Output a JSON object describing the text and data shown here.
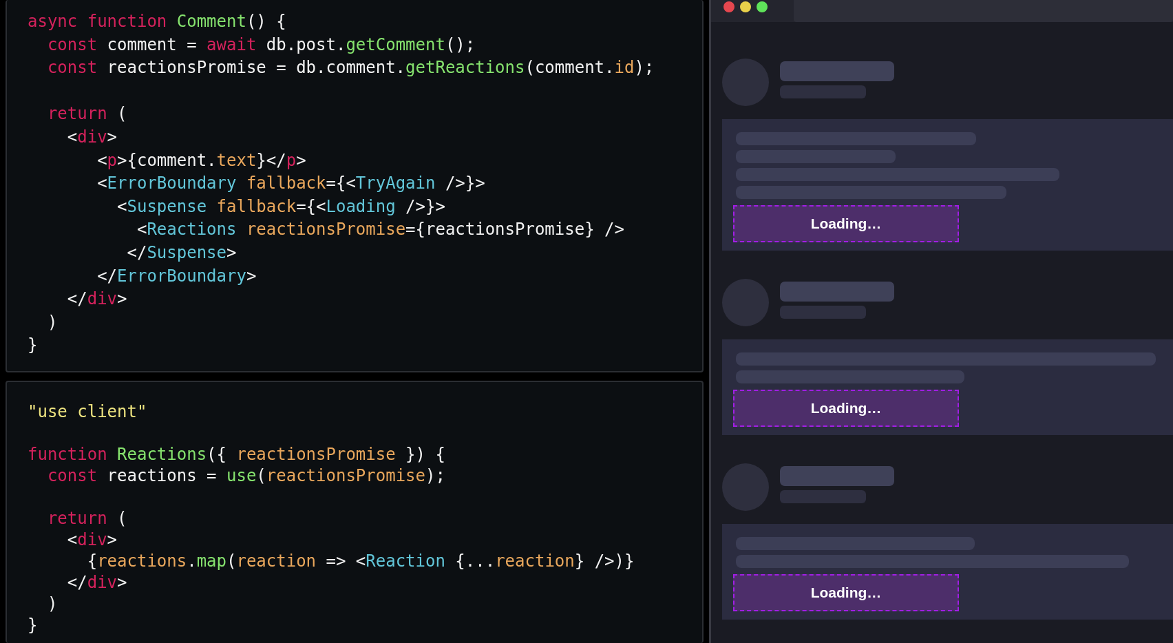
{
  "code_panels": [
    {
      "lines": [
        [
          {
            "kind": "keyword",
            "text": "async function "
          },
          {
            "kind": "fn",
            "text": "Comment"
          },
          {
            "kind": "plain",
            "text": "() {"
          }
        ],
        [
          {
            "kind": "keyword",
            "text": "  const "
          },
          {
            "kind": "plain",
            "text": "comment = "
          },
          {
            "kind": "keyword",
            "text": "await "
          },
          {
            "kind": "plain",
            "text": "db.post."
          },
          {
            "kind": "fn",
            "text": "getComment"
          },
          {
            "kind": "plain",
            "text": "();"
          }
        ],
        [
          {
            "kind": "keyword",
            "text": "  const "
          },
          {
            "kind": "plain",
            "text": "reactionsPromise = db.comment."
          },
          {
            "kind": "fn",
            "text": "getReactions"
          },
          {
            "kind": "plain",
            "text": "(comment."
          },
          {
            "kind": "attr",
            "text": "id"
          },
          {
            "kind": "plain",
            "text": ");"
          }
        ],
        [
          {
            "kind": "blank"
          }
        ],
        [
          {
            "kind": "keyword",
            "text": "  return "
          },
          {
            "kind": "plain",
            "text": "("
          }
        ],
        [
          {
            "kind": "plain",
            "text": "    <"
          },
          {
            "kind": "keyword",
            "text": "div"
          },
          {
            "kind": "plain",
            "text": ">"
          }
        ],
        [
          {
            "kind": "plain",
            "text": "       <"
          },
          {
            "kind": "keyword",
            "text": "p"
          },
          {
            "kind": "plain",
            "text": ">{comment."
          },
          {
            "kind": "attr",
            "text": "text"
          },
          {
            "kind": "plain",
            "text": "}</"
          },
          {
            "kind": "keyword",
            "text": "p"
          },
          {
            "kind": "plain",
            "text": ">"
          }
        ],
        [
          {
            "kind": "plain",
            "text": "       <"
          },
          {
            "kind": "component",
            "text": "ErrorBoundary "
          },
          {
            "kind": "attr",
            "text": "fallback"
          },
          {
            "kind": "plain",
            "text": "={<"
          },
          {
            "kind": "component",
            "text": "TryAgain"
          },
          {
            "kind": "plain",
            "text": " />}>"
          }
        ],
        [
          {
            "kind": "plain",
            "text": "         <"
          },
          {
            "kind": "component",
            "text": "Suspense "
          },
          {
            "kind": "attr",
            "text": "fallback"
          },
          {
            "kind": "plain",
            "text": "={<"
          },
          {
            "kind": "component",
            "text": "Loading"
          },
          {
            "kind": "plain",
            "text": " />}>"
          }
        ],
        [
          {
            "kind": "plain",
            "text": "           <"
          },
          {
            "kind": "component",
            "text": "Reactions "
          },
          {
            "kind": "attr",
            "text": "reactionsPromise"
          },
          {
            "kind": "plain",
            "text": "={reactionsPromise} />"
          }
        ],
        [
          {
            "kind": "plain",
            "text": "          </"
          },
          {
            "kind": "component",
            "text": "Suspense"
          },
          {
            "kind": "plain",
            "text": ">"
          }
        ],
        [
          {
            "kind": "plain",
            "text": "       </"
          },
          {
            "kind": "component",
            "text": "ErrorBoundary"
          },
          {
            "kind": "plain",
            "text": ">"
          }
        ],
        [
          {
            "kind": "plain",
            "text": "    </"
          },
          {
            "kind": "keyword",
            "text": "div"
          },
          {
            "kind": "plain",
            "text": ">"
          }
        ],
        [
          {
            "kind": "plain",
            "text": "  )"
          }
        ],
        [
          {
            "kind": "plain",
            "text": "}"
          }
        ]
      ]
    },
    {
      "lines": [
        [
          {
            "kind": "string",
            "text": "\"use client\""
          }
        ],
        [
          {
            "kind": "blank"
          }
        ],
        [
          {
            "kind": "keyword",
            "text": "function "
          },
          {
            "kind": "fn",
            "text": "Reactions"
          },
          {
            "kind": "plain",
            "text": "({ "
          },
          {
            "kind": "attr",
            "text": "reactionsPromise"
          },
          {
            "kind": "plain",
            "text": " }) {"
          }
        ],
        [
          {
            "kind": "keyword",
            "text": "  const "
          },
          {
            "kind": "plain",
            "text": "reactions = "
          },
          {
            "kind": "fn",
            "text": "use"
          },
          {
            "kind": "plain",
            "text": "("
          },
          {
            "kind": "attr",
            "text": "reactionsPromise"
          },
          {
            "kind": "plain",
            "text": ");"
          }
        ],
        [
          {
            "kind": "blank"
          }
        ],
        [
          {
            "kind": "keyword",
            "text": "  return "
          },
          {
            "kind": "plain",
            "text": "("
          }
        ],
        [
          {
            "kind": "plain",
            "text": "    <"
          },
          {
            "kind": "keyword",
            "text": "div"
          },
          {
            "kind": "plain",
            "text": ">"
          }
        ],
        [
          {
            "kind": "plain",
            "text": "      {"
          },
          {
            "kind": "attr",
            "text": "reactions"
          },
          {
            "kind": "plain",
            "text": "."
          },
          {
            "kind": "fn",
            "text": "map"
          },
          {
            "kind": "plain",
            "text": "("
          },
          {
            "kind": "attr",
            "text": "reaction"
          },
          {
            "kind": "plain",
            "text": " => <"
          },
          {
            "kind": "component",
            "text": "Reaction"
          },
          {
            "kind": "plain",
            "text": " {..."
          },
          {
            "kind": "attr",
            "text": "reaction"
          },
          {
            "kind": "plain",
            "text": "} />)}"
          }
        ],
        [
          {
            "kind": "plain",
            "text": "    </"
          },
          {
            "kind": "keyword",
            "text": "div"
          },
          {
            "kind": "plain",
            "text": ">"
          }
        ],
        [
          {
            "kind": "plain",
            "text": "  )"
          }
        ],
        [
          {
            "kind": "plain",
            "text": "}"
          }
        ]
      ]
    }
  ],
  "browser": {
    "comments": [
      {
        "loading_label": "Loading…"
      },
      {
        "loading_label": "Loading…"
      },
      {
        "loading_label": "Loading…"
      }
    ]
  }
}
